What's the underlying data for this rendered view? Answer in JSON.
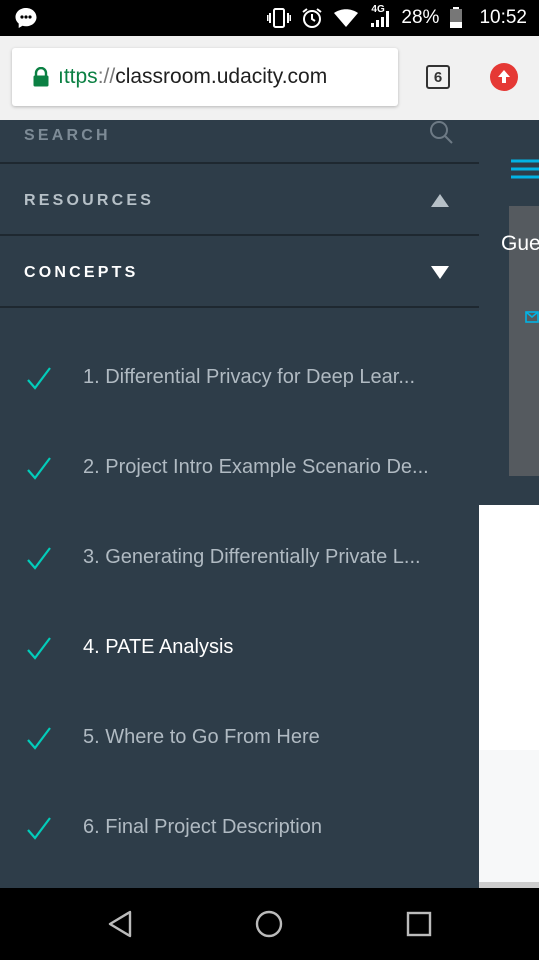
{
  "status_bar": {
    "network_label": "4G",
    "battery_pct": "28%",
    "time": "10:52"
  },
  "browser": {
    "url_scheme": "ıttps",
    "url_sep": "://",
    "url_host": "classroom.udacity.com",
    "tab_count": "6"
  },
  "page": {
    "hero_text": "Gue"
  },
  "drawer": {
    "search_label": "SEARCH",
    "resources_label": "RESOURCES",
    "concepts_label": "CONCEPTS",
    "concepts": [
      {
        "label": "1. Differential Privacy for Deep Lear...",
        "completed": true,
        "active": false
      },
      {
        "label": "2. Project Intro Example Scenario De...",
        "completed": true,
        "active": false
      },
      {
        "label": "3. Generating Differentially Private L...",
        "completed": true,
        "active": false
      },
      {
        "label": "4. PATE Analysis",
        "completed": true,
        "active": true
      },
      {
        "label": "5. Where to Go From Here",
        "completed": true,
        "active": false
      },
      {
        "label": "6. Final Project Description",
        "completed": true,
        "active": false
      }
    ]
  },
  "colors": {
    "drawer_bg": "#2e3d49",
    "check": "#02ccba",
    "url_scheme": "#0b8043",
    "upload_btn": "#e53935"
  }
}
